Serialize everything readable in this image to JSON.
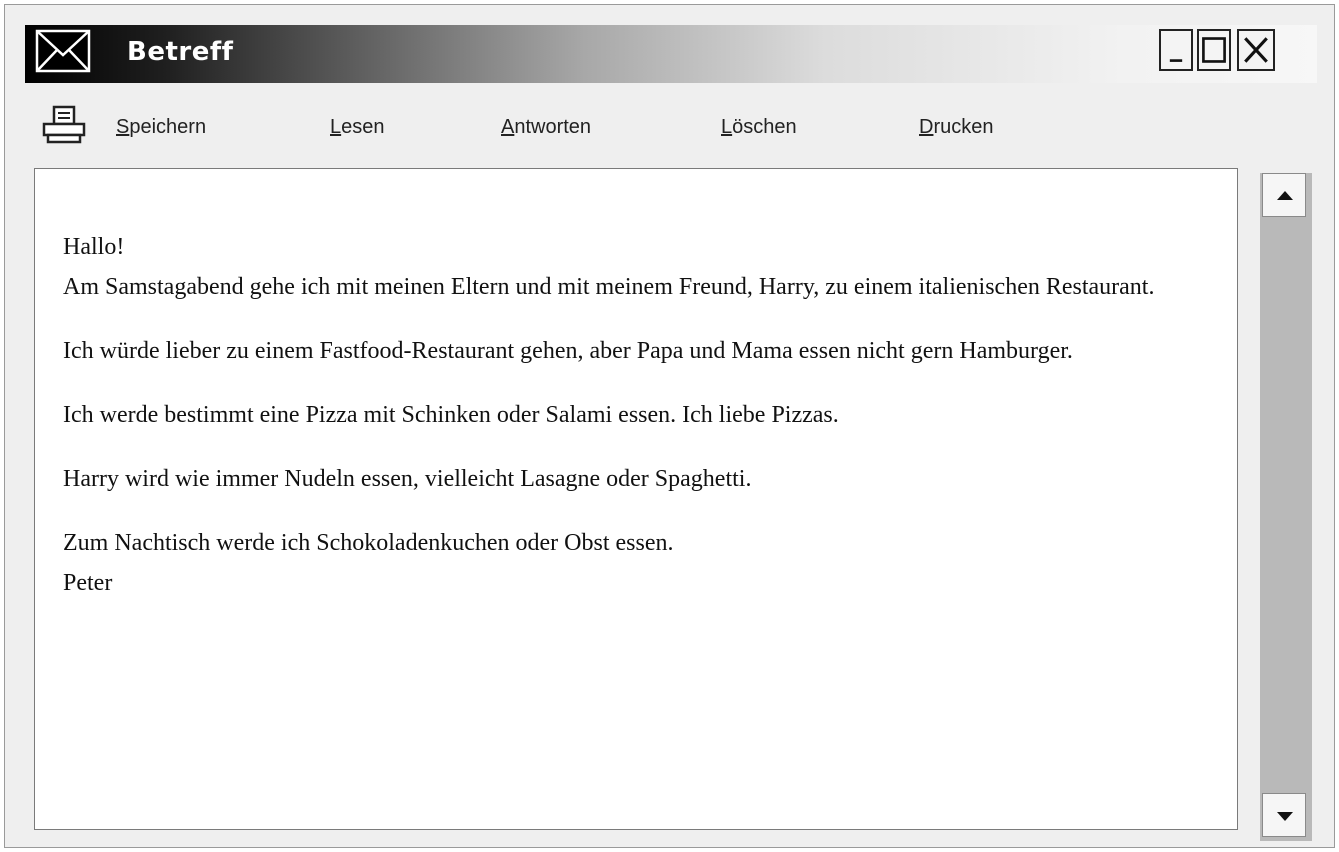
{
  "window": {
    "title": "Betreff",
    "controls": {
      "minimize": "_",
      "maximize": "□",
      "close": "X"
    }
  },
  "toolbar": {
    "icon": "printer-icon",
    "items": [
      {
        "first": "S",
        "rest": "peichern"
      },
      {
        "first": "L",
        "rest": "esen"
      },
      {
        "first": "A",
        "rest": "ntworten"
      },
      {
        "first": "L",
        "rest": "öschen"
      },
      {
        "first": "D",
        "rest": "rucken"
      }
    ]
  },
  "message": {
    "greeting": "Hallo!",
    "paragraphs": [
      "Am Samstagabend gehe ich mit meinen Eltern und mit meinem Freund, Harry, zu einem italienischen Restaurant.",
      "Ich würde lieber zu einem Fastfood-Restaurant gehen, aber Papa und Mama essen nicht gern Hamburger.",
      "Ich werde bestimmt eine Pizza mit Schinken oder Salami essen. Ich liebe Pizzas.",
      "Harry wird wie immer Nudeln essen, vielleicht Lasagne oder Spaghetti.",
      "Zum Nachtisch werde ich Schokoladenkuchen oder Obst essen."
    ],
    "signature": "Peter"
  },
  "scrollbar": {
    "up_icon": "arrow-up-icon",
    "down_icon": "arrow-down-icon"
  }
}
